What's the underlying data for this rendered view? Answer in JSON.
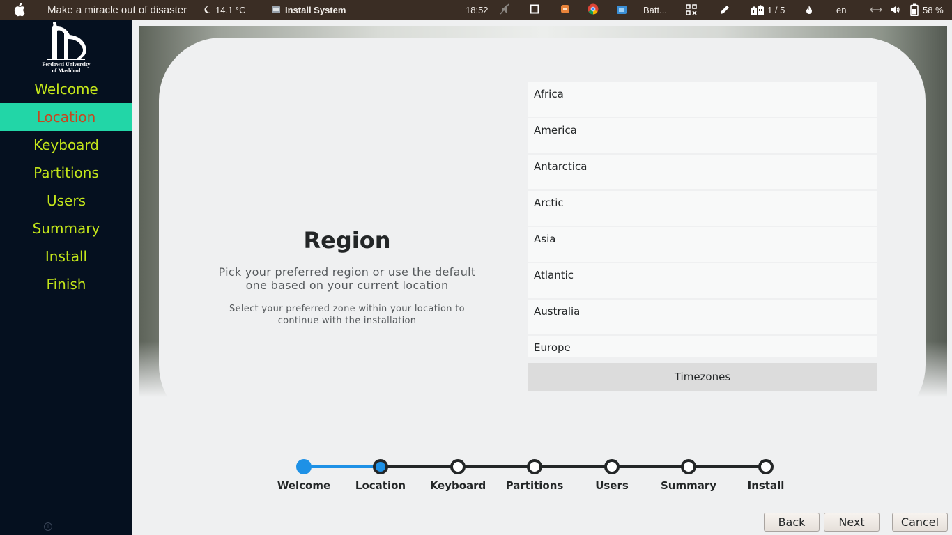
{
  "topbar": {
    "app_title": "Make a miracle out of disaster",
    "weather_temp": "14.1 °C",
    "task_title": "Install System",
    "clock": "18:52",
    "battery_tray_label": "Batt...",
    "workspace": "1 / 5",
    "language": "en",
    "battery_percent": "58 %"
  },
  "sidebar": {
    "logo_text_line1": "Ferdowsi University",
    "logo_text_line2": "of Mashhad",
    "items": [
      {
        "label": "Welcome"
      },
      {
        "label": "Location",
        "active": true
      },
      {
        "label": "Keyboard"
      },
      {
        "label": "Partitions"
      },
      {
        "label": "Users"
      },
      {
        "label": "Summary"
      },
      {
        "label": "Install"
      },
      {
        "label": "Finish"
      }
    ]
  },
  "main": {
    "heading": "Region",
    "subtitle": "Pick your preferred region or use the default one based on your current location",
    "hint": "Select your preferred zone within your location to continue with the installation",
    "regions": [
      "Africa",
      "America",
      "Antarctica",
      "Arctic",
      "Asia",
      "Atlantic",
      "Australia",
      "Europe"
    ],
    "timezones_button": "Timezones"
  },
  "stepper": {
    "steps": [
      "Welcome",
      "Location",
      "Keyboard",
      "Partitions",
      "Users",
      "Summary",
      "Install"
    ],
    "current_index": 1,
    "colors": {
      "done": "#1e91e6",
      "pending": "#232627"
    }
  },
  "buttons": {
    "back": "Back",
    "next": "Next",
    "cancel": "Cancel"
  }
}
